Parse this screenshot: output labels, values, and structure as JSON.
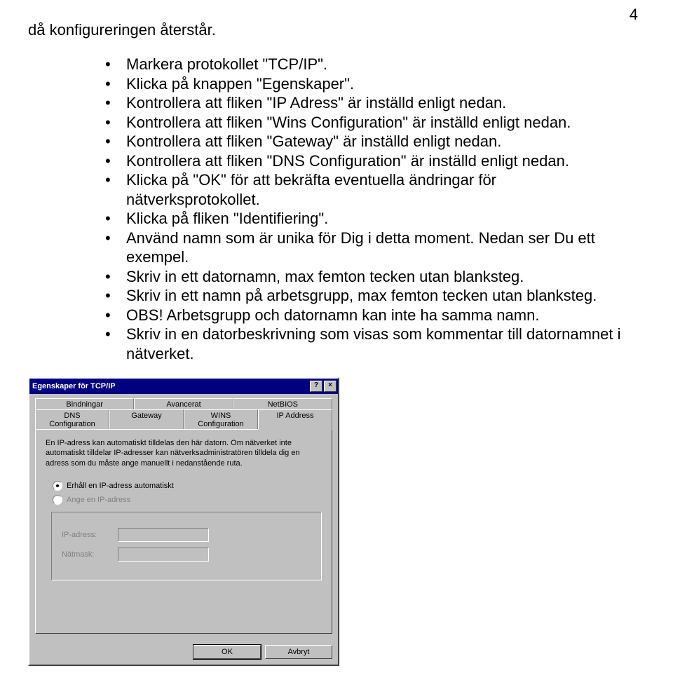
{
  "page_number": "4",
  "heading": "då konfigureringen återstår.",
  "bullets": [
    "Markera protokollet \"TCP/IP\".",
    "Klicka på knappen \"Egenskaper\".",
    "Kontrollera att fliken \"IP Adress\" är inställd enligt nedan.",
    "Kontrollera att fliken \"Wins Configuration\" är inställd enligt nedan.",
    "Kontrollera att fliken \"Gateway\" är inställd enligt nedan.",
    "Kontrollera att fliken \"DNS Configuration\" är inställd enligt nedan.",
    "Klicka på \"OK\" för att bekräfta eventuella ändringar för nätverksprotokollet.",
    "Klicka på fliken \"Identifiering\".",
    "Använd namn som är unika för Dig i detta moment. Nedan ser Du ett exempel.",
    "Skriv in ett datornamn, max femton tecken utan blanksteg.",
    "Skriv in ett namn på arbetsgrupp, max femton tecken utan blanksteg.",
    "OBS! Arbetsgrupp och datornamn kan inte ha samma namn.",
    "Skriv in en datorbeskrivning som visas som kommentar till datornamnet i nätverket."
  ],
  "dialog": {
    "title": "Egenskaper för TCP/IP",
    "help_btn": "?",
    "close_btn": "×",
    "tabs_top": [
      "Bindningar",
      "Avancerat",
      "NetBIOS"
    ],
    "tabs_bottom": [
      "DNS Configuration",
      "Gateway",
      "WINS Configuration",
      "IP Address"
    ],
    "active_tab": "IP Address",
    "description": "En IP-adress kan automatiskt tilldelas den här datorn. Om nätverket inte automatiskt tilldelar IP-adresser kan nätverksadministratören tilldela dig en adress som du måste ange manuellt i nedanstående ruta.",
    "radio1": "Erhåll en IP-adress automatiskt",
    "radio2": "Ange en IP-adress",
    "field_ip": "IP-adress:",
    "field_mask": "Nätmask:",
    "ok": "OK",
    "cancel": "Avbryt"
  }
}
